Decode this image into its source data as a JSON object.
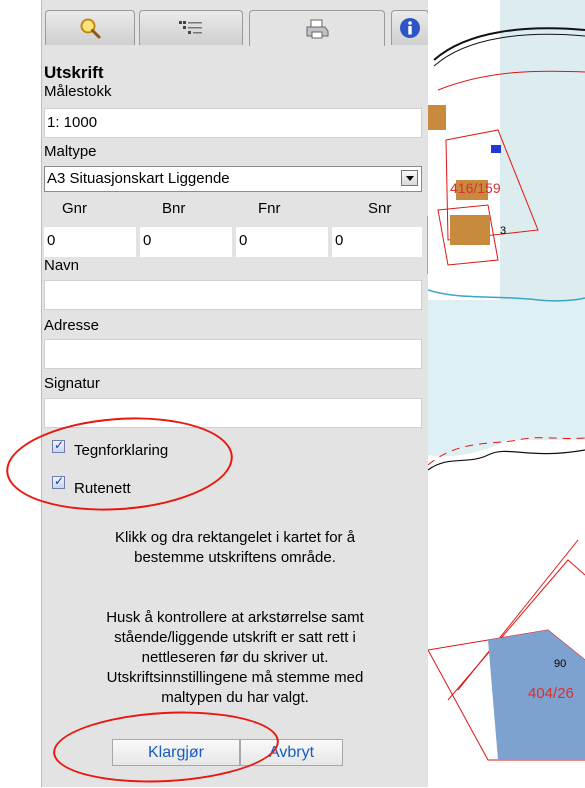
{
  "tabs": [
    {
      "icon": "search-icon"
    },
    {
      "icon": "layers-icon"
    },
    {
      "icon": "printer-icon",
      "active": true
    },
    {
      "icon": "info-icon"
    }
  ],
  "print": {
    "title": "Utskrift",
    "scale_label": "Målestokk",
    "scale_value": "1: 1000",
    "template_label": "Maltype",
    "template_value": "A3 Situasjonskart Liggende",
    "columns": [
      "Gnr",
      "Bnr",
      "Fnr",
      "Snr"
    ],
    "values": [
      "0",
      "0",
      "0",
      "0"
    ],
    "name_label": "Navn",
    "address_label": "Adresse",
    "signature_label": "Signatur",
    "legend_label": "Tegnforklaring",
    "grid_label": "Rutenett",
    "info1_line1": "Klikk og dra rektangelet i kartet for å",
    "info1_line2": "bestemme utskriftens område.",
    "info2_line1": "Husk å kontrollere at arkstørrelse samt",
    "info2_line2": "stående/liggende utskrift er satt rett i",
    "info2_line3": "nettleseren før du skriver ut.",
    "info2_line4": "Utskriftsinnstillingene må stemme med",
    "info2_line5": "maltypen du har valgt.",
    "prepare_button": "Klargjør",
    "cancel_button": "Avbryt"
  },
  "map": {
    "labels": [
      "416/159",
      "3",
      "90",
      "404/26"
    ]
  }
}
